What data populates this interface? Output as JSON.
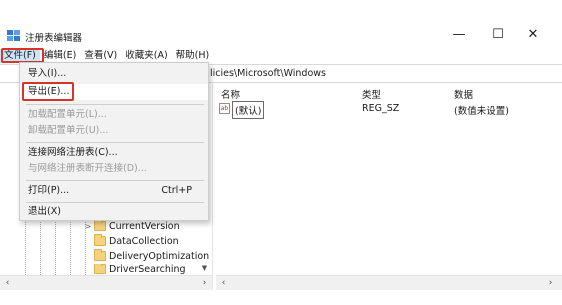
{
  "window": {
    "title": "注册表编辑器",
    "minimize": "—",
    "maximize": "☐",
    "close": "✕"
  },
  "menubar": {
    "items": [
      {
        "label": "文件(F)"
      },
      {
        "label": "编辑(E)"
      },
      {
        "label": "查看(V)"
      },
      {
        "label": "收藏夹(A)"
      },
      {
        "label": "帮助(H)"
      }
    ]
  },
  "address": {
    "path_visible": "licies\\Microsoft\\Windows"
  },
  "file_menu": {
    "import": "导入(I)...",
    "export": "导出(E)...",
    "load_hive": "加载配置单元(L)...",
    "unload_hive": "卸载配置单元(U)...",
    "connect": "连接网络注册表(C)...",
    "disconnect": "与网络注册表断开连接(D)...",
    "print": "打印(P)...",
    "print_shortcut": "Ctrl+P",
    "exit": "退出(X)"
  },
  "tree": {
    "items": [
      {
        "label": "CurrentVersion",
        "expander": ">"
      },
      {
        "label": "DataCollection",
        "expander": ""
      },
      {
        "label": "DeliveryOptimization",
        "expander": ""
      },
      {
        "label": "DriverSearching",
        "expander": ""
      }
    ]
  },
  "list": {
    "headers": {
      "name": "名称",
      "type": "类型",
      "data": "数据"
    },
    "rows": [
      {
        "icon": "ab",
        "name": "(默认)",
        "type": "REG_SZ",
        "data": "(数值未设置)"
      }
    ]
  },
  "colors": {
    "highlight_red": "#d6332a",
    "menu_active": "#cce4f7",
    "folder": "#f5d27d"
  }
}
